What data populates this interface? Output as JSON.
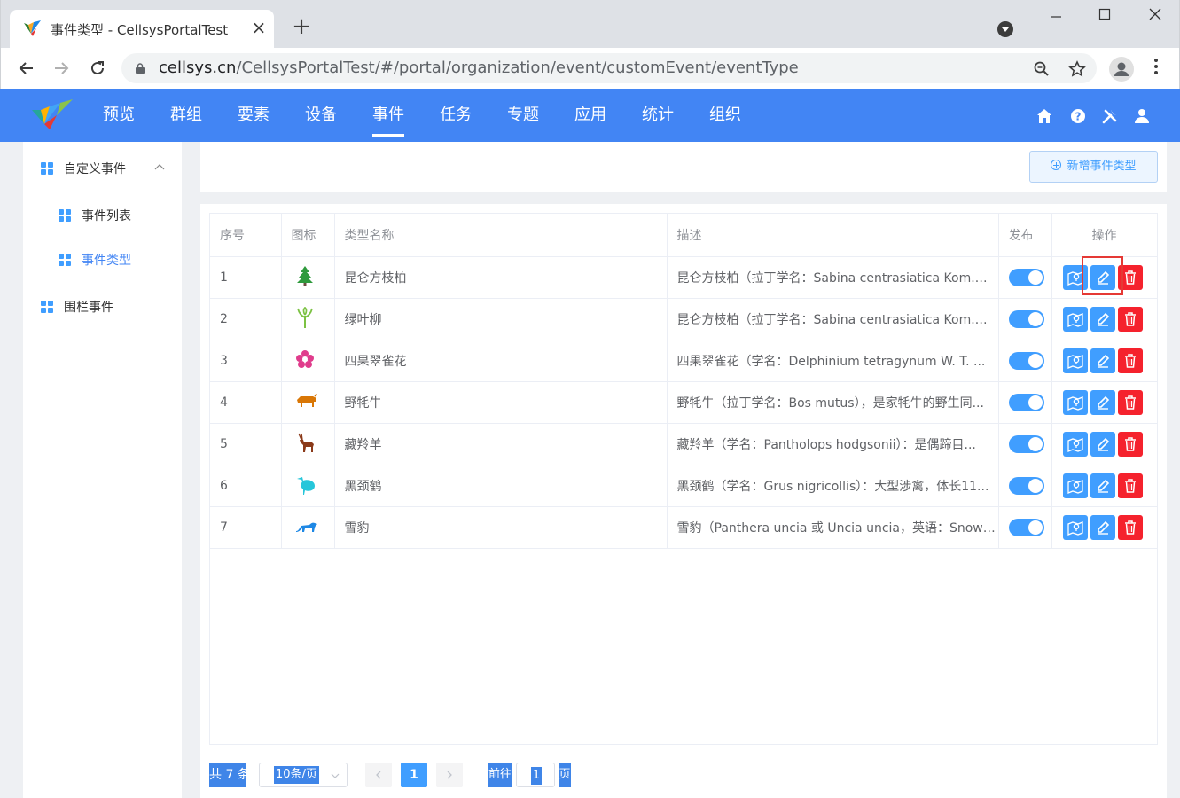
{
  "browser": {
    "tab_title": "事件类型 - CellsysPortalTest",
    "url_host": "cellsys.cn",
    "url_path": "/CellsysPortalTest/#/portal/organization/event/customEvent/eventType"
  },
  "header": {
    "menu": [
      {
        "label": "预览"
      },
      {
        "label": "群组"
      },
      {
        "label": "要素"
      },
      {
        "label": "设备"
      },
      {
        "label": "事件",
        "active": true
      },
      {
        "label": "任务"
      },
      {
        "label": "专题"
      },
      {
        "label": "应用"
      },
      {
        "label": "统计"
      },
      {
        "label": "组织"
      }
    ],
    "accent_color": "#4285f4"
  },
  "sidebar": {
    "items": [
      {
        "label": "自定义事件"
      },
      {
        "label": "事件列表"
      },
      {
        "label": "事件类型",
        "active": true
      },
      {
        "label": "围栏事件"
      }
    ]
  },
  "toolbar": {
    "add_label": "新增事件类型"
  },
  "table": {
    "headers": [
      "序号",
      "图标",
      "类型名称",
      "描述",
      "发布",
      "操作"
    ],
    "rows": [
      {
        "no": "1",
        "icon": "tree-icon",
        "name": "昆仑方枝柏",
        "desc": "昆仑方枝柏（拉丁学名：Sabina centrasiatica Kom.）...",
        "published": true
      },
      {
        "no": "2",
        "icon": "willow-icon",
        "name": "绿叶柳",
        "desc": "昆仑方枝柏（拉丁学名：Sabina centrasiatica Kom.）...",
        "published": true
      },
      {
        "no": "3",
        "icon": "flower-icon",
        "name": "四果翠雀花",
        "desc": "四果翠雀花（学名：Delphinium tetragynum W. T. ...",
        "published": true
      },
      {
        "no": "4",
        "icon": "yak-icon",
        "name": "野牦牛",
        "desc": "野牦牛（拉丁学名：Bos mutus），是家牦牛的野生同...",
        "published": true
      },
      {
        "no": "5",
        "icon": "antelope-icon",
        "name": "藏羚羊",
        "desc": "藏羚羊（学名：Pantholops hodgsonii）：是偶蹄目...",
        "published": true
      },
      {
        "no": "6",
        "icon": "crane-icon",
        "name": "黑颈鹤",
        "desc": "黑颈鹤（学名：Grus nigricollis）：大型涉禽，体长11...",
        "published": true
      },
      {
        "no": "7",
        "icon": "leopard-icon",
        "name": "雪豹",
        "desc": "雪豹（Panthera uncia 或 Uncia uncia，英语：Snow ...",
        "published": true
      }
    ]
  },
  "pagination": {
    "total": "共 7 条",
    "page_size": "10条/页",
    "current_page": "1",
    "goto_label": "前往",
    "goto_value": "1",
    "page_suffix": "页"
  }
}
